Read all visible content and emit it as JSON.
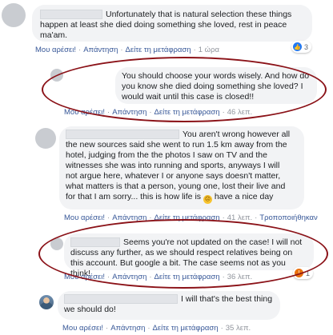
{
  "comments": [
    {
      "text": "Unfortunately that is natural selection these things happen at least she died doing something she loved, rest in peace ma'am.",
      "like": "Μου αρέσει!",
      "reply": "Απάντηση",
      "translate": "Δείτε τη μετάφραση",
      "time": "1 ώρα",
      "reactions": "3"
    },
    {
      "text": "You should choose your words wisely. And how do you know she died doing something she loved? I would wait until this case is closed!!",
      "like": "Μου αρέσει!",
      "reply": "Απάντηση",
      "translate": "Δείτε τη μετάφραση",
      "time": "46 λεπ."
    },
    {
      "text_lines": [
        "You aren't wrong however all",
        "the new sources said she went to run 1.5 km away from the",
        "hotel, judging from the the photos I saw on TV and the",
        "witnesses she was into running and sports, anyways I will",
        "not argue here, whatever I or anyone says doesn't matter,",
        "what matters is that a person, young one, lost their live and",
        "for that I am sorry... this is how life is"
      ],
      "text_tail": " have a nice day",
      "emoji": "frowning-face",
      "like": "Μου αρέσει!",
      "reply": "Απάντηση",
      "translate": "Δείτε τη μετάφραση",
      "time": "41 λεπ.",
      "edited": "Τροποποιήθηκαν"
    },
    {
      "text": "Seems you're not updated on the case! I will not discuss any further, as we should respect relatives being on this account. But google a bit. The case seems not as you think!",
      "like": "Μου αρέσει!",
      "reply": "Απάντηση",
      "translate": "Δείτε τη μετάφραση",
      "time": "36 λεπ.",
      "reactions": "1"
    },
    {
      "text": "I will that's the best thing we should do!",
      "like": "Μου αρέσει!",
      "reply": "Απάντηση",
      "translate": "Δείτε τη μετάφραση",
      "time": "35 λεπ."
    }
  ],
  "colors": {
    "link": "#385898",
    "bubble": "#f2f3f5",
    "marker": "#8b1218"
  },
  "icons": [
    "like-icon",
    "angry-icon",
    "frowning-emoji"
  ]
}
